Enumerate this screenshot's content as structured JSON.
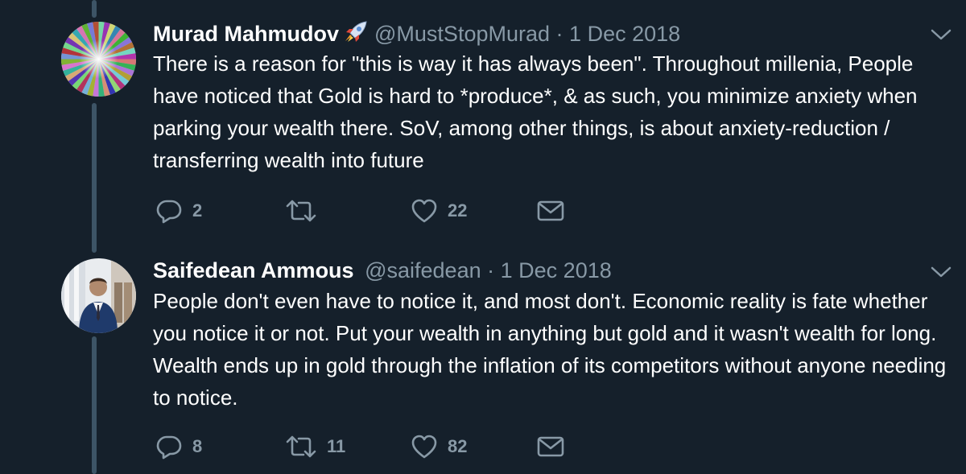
{
  "tweets": [
    {
      "name": "Murad Mahmudov",
      "emoji": "rocket-emoji",
      "handle": "@MustStopMurad",
      "separator": "·",
      "date": "1 Dec 2018",
      "text": "There is a reason for \"this is way it has always been\". Throughout millenia, People have noticed that Gold is hard to *produce*, & as such, you minimize anxiety when parking your wealth there. SoV, among other things, is about anxiety-reduction /  transferring wealth into future",
      "replies": "2",
      "retweets": "",
      "likes": "22"
    },
    {
      "name": "Saifedean Ammous",
      "handle": "@saifedean",
      "separator": "·",
      "date": "1 Dec 2018",
      "text": "People don't even have to notice it, and most don't. Economic reality is fate whether you notice it or not. Put your wealth in anything but gold and it wasn't wealth for long. Wealth ends up in gold through the inflation of its competitors without anyone needing to notice.",
      "replies": "8",
      "retweets": "11",
      "likes": "82"
    }
  ],
  "colors": {
    "background": "#15202b",
    "text_primary": "#ffffff",
    "text_secondary": "#8899a6",
    "thread_line": "#3d5466"
  },
  "icons": {
    "reply": "reply-icon",
    "retweet": "retweet-icon",
    "like": "heart-icon",
    "message": "envelope-icon",
    "more": "chevron-down-icon"
  }
}
